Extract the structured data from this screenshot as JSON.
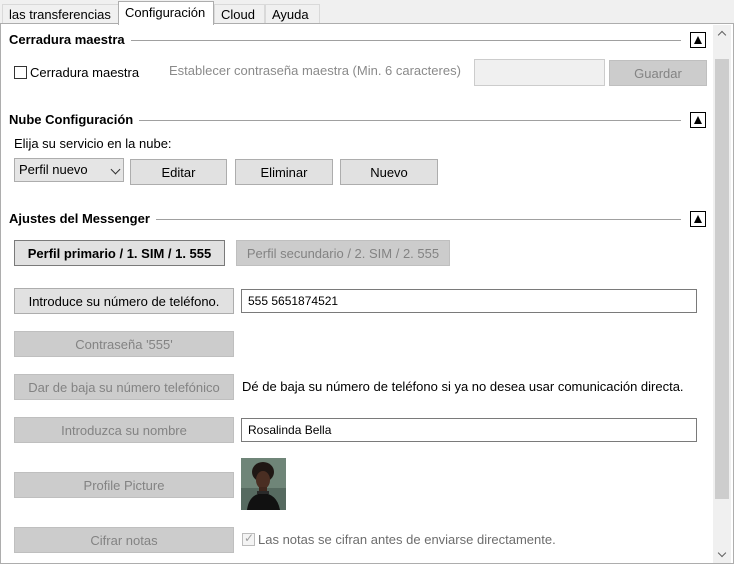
{
  "tabs": [
    {
      "label": "las transferencias"
    },
    {
      "label": "Configuración"
    },
    {
      "label": "Cloud"
    },
    {
      "label": "Ayuda"
    }
  ],
  "master_lock": {
    "title": "Cerradura maestra",
    "checkbox_label": "Cerradura maestra",
    "password_label": "Establecer contraseña maestra (Min. 6 caracteres)",
    "password_value": "",
    "save_label": "Guardar"
  },
  "cloud": {
    "title": "Nube Configuración",
    "prompt": "Elija su servicio en la nube:",
    "profile_selected": "Perfil nuevo",
    "edit_label": "Editar",
    "delete_label": "Eliminar",
    "new_label": "Nuevo"
  },
  "messenger": {
    "title": "Ajustes del Messenger",
    "primary_profile": "Perfil primario / 1. SIM / 1. 555",
    "secondary_profile": "Perfil secundario / 2. SIM / 2. 555",
    "phone_button": "Introduce su número de teléfono.",
    "phone_value": "555 5651874521",
    "password_button": "Contraseña '555'",
    "unsubscribe_button": "Dar de baja su número telefónico",
    "unsubscribe_text": "Dé de baja su número de teléfono si ya no desea usar comunicación directa.",
    "name_button": "Introduzca su nombre",
    "name_value": "Rosalinda Bella",
    "picture_button": "Profile Picture",
    "encrypt_button": "Cifrar notas",
    "encrypt_label": "Las notas se cifran antes de enviarse directamente."
  },
  "icons": {
    "collapse": "collapse-up-icon",
    "scroll_up": "chevron-up-icon",
    "scroll_down": "chevron-down-icon",
    "checkmark": "checkmark-icon"
  }
}
